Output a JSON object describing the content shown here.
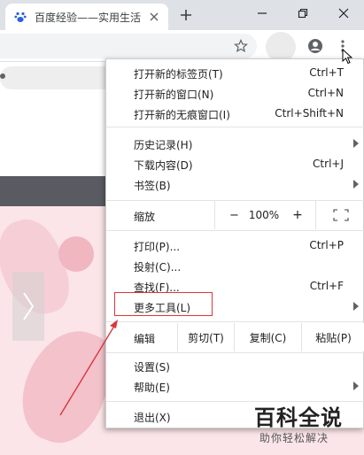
{
  "tab": {
    "title": "百度经验——实用生活",
    "favicon": "paw-icon"
  },
  "window_controls": {
    "minimize": "minimize-icon",
    "restore": "restore-icon",
    "close": "close-icon"
  },
  "menu": {
    "items": [
      {
        "label": "打开新的标签页(T)",
        "shortcut": "Ctrl+T"
      },
      {
        "label": "打开新的窗口(N)",
        "shortcut": "Ctrl+N"
      },
      {
        "label": "打开新的无痕窗口(I)",
        "shortcut": "Ctrl+Shift+N"
      },
      {
        "label": "历史记录(H)",
        "shortcut": ""
      },
      {
        "label": "下载内容(D)",
        "shortcut": "Ctrl+J"
      },
      {
        "label": "书签(B)",
        "shortcut": ""
      },
      {
        "label": "打印(P)...",
        "shortcut": "Ctrl+P"
      },
      {
        "label": "投射(C)...",
        "shortcut": ""
      },
      {
        "label": "查找(F)...",
        "shortcut": "Ctrl+F"
      },
      {
        "label": "更多工具(L)",
        "shortcut": ""
      },
      {
        "label": "设置(S)",
        "shortcut": ""
      },
      {
        "label": "帮助(E)",
        "shortcut": ""
      },
      {
        "label": "退出(X)",
        "shortcut": ""
      }
    ],
    "zoom": {
      "label": "缩放",
      "minus": "−",
      "value": "100%",
      "plus": "+"
    },
    "edit": {
      "label": "编辑",
      "cut": "剪切(T)",
      "copy": "复制(C)",
      "paste": "粘贴(P)"
    }
  },
  "watermark": {
    "title": "百科全说",
    "subtitle": "助你轻松解决"
  },
  "colors": {
    "highlight": "#d9363e",
    "tabstrip": "#dee1e6",
    "page_band": "#5a5a62",
    "page_art": "#fbe5e8"
  }
}
